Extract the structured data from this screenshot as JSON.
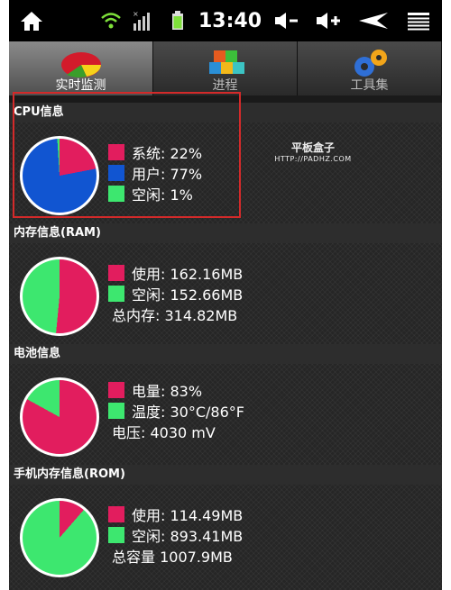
{
  "status_bar": {
    "time": "13:40"
  },
  "tabs": [
    {
      "label": "实时监测",
      "active": true
    },
    {
      "label": "进程",
      "active": false
    },
    {
      "label": "工具集",
      "active": false
    }
  ],
  "colors": {
    "pie_red": "#e21d5e",
    "pie_blue": "#1155d1",
    "pie_green": "#3de76f",
    "highlight_box": "#d42a2a"
  },
  "watermark": {
    "line1": "平板盒子",
    "line2": "HTTP://PADHZ.COM"
  },
  "cpu": {
    "title": "CPU信息",
    "items": [
      {
        "label": "系统: 22%",
        "color": "#e21d5e",
        "value": 22
      },
      {
        "label": "用户: 77%",
        "color": "#1155d1",
        "value": 77
      },
      {
        "label": "空闲: 1%",
        "color": "#3de76f",
        "value": 1
      }
    ]
  },
  "ram": {
    "title": "内存信息(RAM)",
    "items": [
      {
        "label": "使用: 162.16MB",
        "color": "#e21d5e",
        "value": 162.16
      },
      {
        "label": "空闲: 152.66MB",
        "color": "#3de76f",
        "value": 152.66
      }
    ],
    "total": "总内存: 314.82MB"
  },
  "battery": {
    "title": "电池信息",
    "items": [
      {
        "label": "电量: 83%",
        "color": "#e21d5e",
        "value": 83
      },
      {
        "label": "温度: 30°C/86°F",
        "color": "#3de76f",
        "value": 17
      }
    ],
    "voltage": "电压: 4030 mV"
  },
  "rom": {
    "title": "手机内存信息(ROM)",
    "items": [
      {
        "label": "使用: 114.49MB",
        "color": "#e21d5e",
        "value": 114.49
      },
      {
        "label": "空闲: 893.41MB",
        "color": "#3de76f",
        "value": 893.41
      }
    ],
    "total": "总容量 1007.9MB"
  }
}
